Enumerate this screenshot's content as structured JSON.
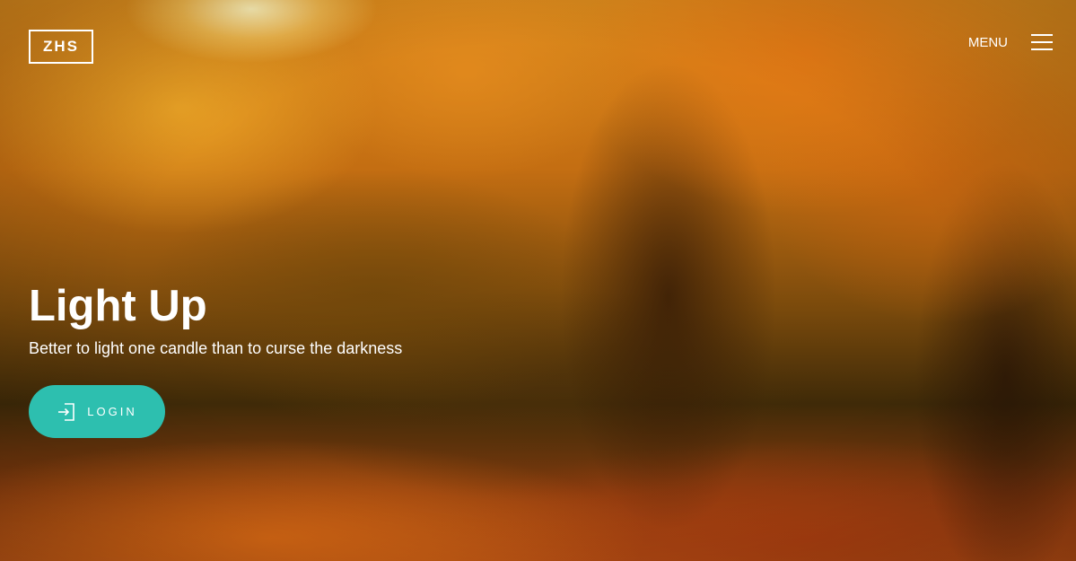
{
  "header": {
    "logo_text": "ZHS",
    "menu_label": "MENU"
  },
  "hero": {
    "title": "Light Up",
    "subtitle": "Better to light one candle than to curse the darkness",
    "login_label": "LOGIN"
  },
  "icons": {
    "menu": "hamburger-icon",
    "login": "login-icon"
  },
  "colors": {
    "accent": "#2dbfaf",
    "text": "#ffffff"
  }
}
